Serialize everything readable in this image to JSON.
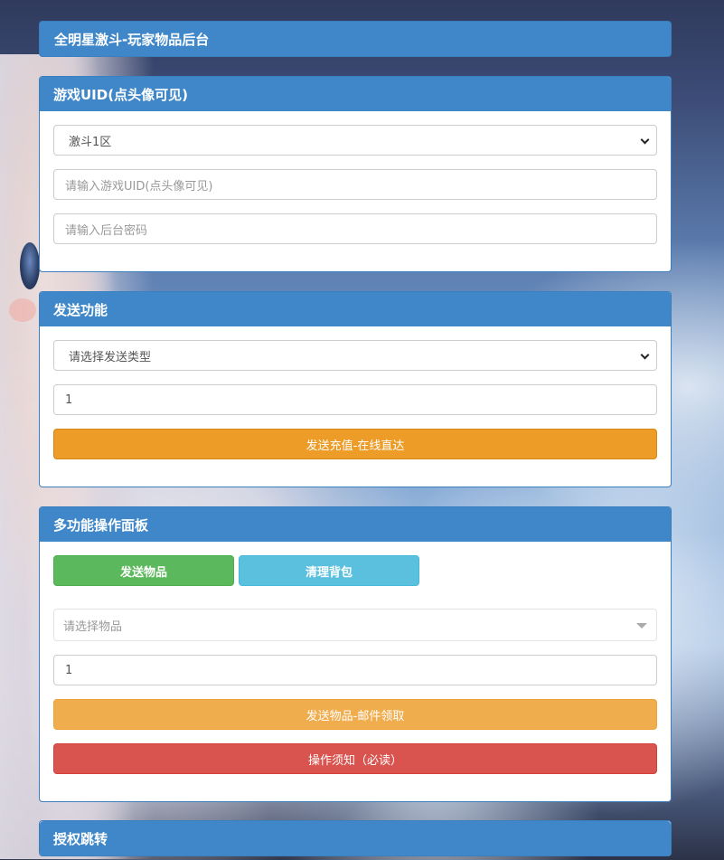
{
  "header": {
    "title": "全明星激斗-玩家物品后台"
  },
  "uid_panel": {
    "title": "游戏UID(点头像可见)",
    "server_select": "激斗1区",
    "uid_placeholder": "请输入游戏UID(点头像可见)",
    "password_placeholder": "请输入后台密码"
  },
  "send_panel": {
    "title": "发送功能",
    "type_select": "请选择发送类型",
    "amount_value": "1",
    "send_button": "发送充值-在线直达"
  },
  "multi_panel": {
    "title": "多功能操作面板",
    "tab_send_items": "发送物品",
    "tab_clear_bag": "清理背包",
    "item_select_placeholder": "请选择物品",
    "quantity_value": "1",
    "send_mail_button": "发送物品-邮件领取",
    "notice_button": "操作须知（必读）"
  },
  "auth_panel": {
    "title": "授权跳转"
  },
  "colors": {
    "panel_header": "#3f87c9",
    "orange_dark": "#ed9c28",
    "orange": "#f0ad4e",
    "red": "#d9534f",
    "green": "#5cb85c",
    "cyan": "#5bc0de"
  },
  "icons": {
    "select_arrow": "chevron-down-icon",
    "dropdown_arrow": "triangle-down-icon"
  }
}
